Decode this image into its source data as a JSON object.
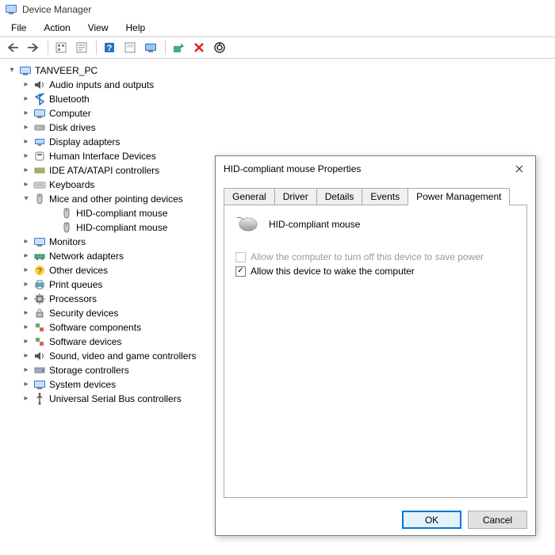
{
  "window": {
    "title": "Device Manager"
  },
  "menubar": [
    "File",
    "Action",
    "View",
    "Help"
  ],
  "tree": {
    "root": "TANVEER_PC",
    "nodes": [
      {
        "label": "Audio inputs and outputs"
      },
      {
        "label": "Bluetooth"
      },
      {
        "label": "Computer"
      },
      {
        "label": "Disk drives"
      },
      {
        "label": "Display adapters"
      },
      {
        "label": "Human Interface Devices"
      },
      {
        "label": "IDE ATA/ATAPI controllers"
      },
      {
        "label": "Keyboards"
      },
      {
        "label": "Mice and other pointing devices",
        "expanded": true,
        "children": [
          "HID-compliant mouse",
          "HID-compliant mouse"
        ]
      },
      {
        "label": "Monitors"
      },
      {
        "label": "Network adapters"
      },
      {
        "label": "Other devices"
      },
      {
        "label": "Print queues"
      },
      {
        "label": "Processors"
      },
      {
        "label": "Security devices"
      },
      {
        "label": "Software components"
      },
      {
        "label": "Software devices"
      },
      {
        "label": "Sound, video and game controllers"
      },
      {
        "label": "Storage controllers"
      },
      {
        "label": "System devices"
      },
      {
        "label": "Universal Serial Bus controllers"
      }
    ]
  },
  "dialog": {
    "title": "HID-compliant mouse Properties",
    "tabs": [
      "General",
      "Driver",
      "Details",
      "Events",
      "Power Management"
    ],
    "active_tab": "Power Management",
    "device_name": "HID-compliant mouse",
    "checkboxes": {
      "turn_off": "Allow the computer to turn off this device to save power",
      "wake": "Allow this device to wake the computer"
    },
    "buttons": {
      "ok": "OK",
      "cancel": "Cancel"
    }
  }
}
